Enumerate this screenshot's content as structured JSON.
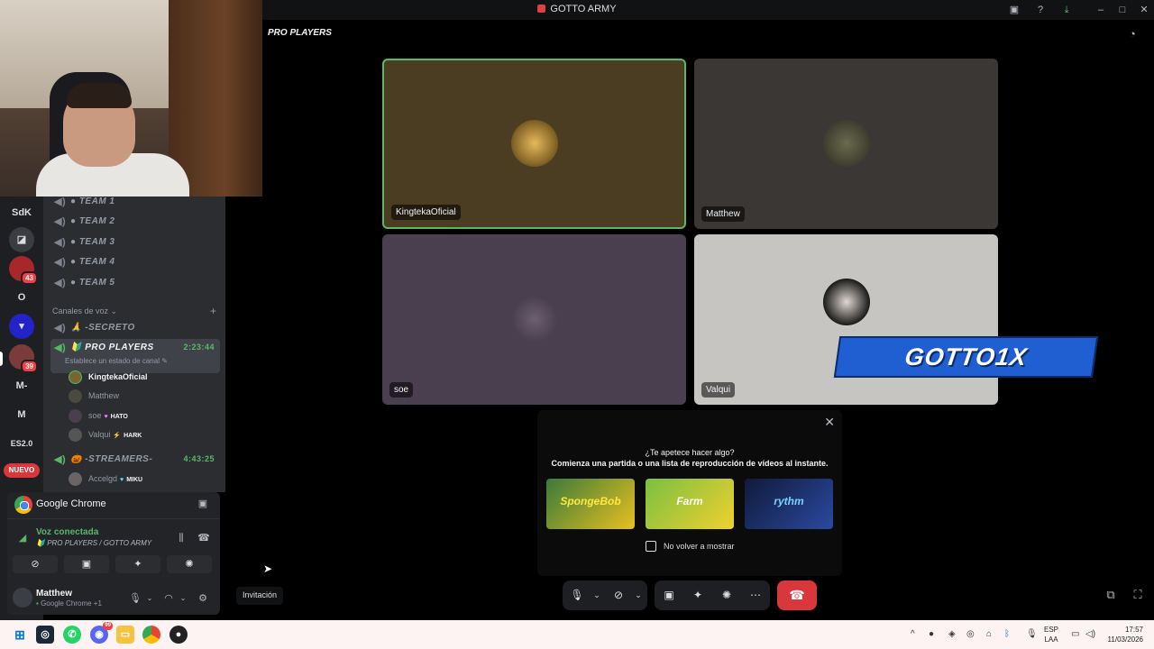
{
  "window": {
    "title": "GOTTO ARMY"
  },
  "stage": {
    "channel_name": "PRO PLAYERS",
    "tiles": [
      {
        "name": "KingtekaOficial",
        "bg": "#4a3d22"
      },
      {
        "name": "Matthew",
        "bg": "#3a3734"
      },
      {
        "name": "soe",
        "bg": "#4a3f4f"
      },
      {
        "name": "Valqui",
        "bg": "#c7c5c2"
      }
    ],
    "overlay_text": "GOTTO1X"
  },
  "servers": [
    {
      "label": "SdK"
    },
    {
      "label": ""
    },
    {
      "label": "",
      "badge": "43"
    },
    {
      "label": "O"
    },
    {
      "label": ""
    },
    {
      "label": "",
      "badge": "39"
    },
    {
      "label": "M-"
    },
    {
      "label": "M"
    },
    {
      "label": "ES2.0"
    },
    {
      "label": "NUEVO"
    }
  ],
  "channels": {
    "text_teams": [
      "TEAM 1",
      "TEAM 2",
      "TEAM 3",
      "TEAM 4",
      "TEAM 5"
    ],
    "voice_category": "Canales de voz",
    "secret": "-SECRETO",
    "active": {
      "name": "PRO PLAYERS",
      "time": "2:23:44",
      "status": "Establece un estado de canal"
    },
    "members": [
      {
        "name": "KingtekaOficial",
        "tag": ""
      },
      {
        "name": "Matthew",
        "tag": ""
      },
      {
        "name": "soe",
        "tag": "HATO"
      },
      {
        "name": "Valqui",
        "tag": "HARK"
      }
    ],
    "streamers": {
      "name": "-STREAMERS-",
      "time": "4:43:25",
      "member": {
        "name": "Accelgd",
        "tag": "MIKU"
      }
    }
  },
  "panel": {
    "app_name": "Google Chrome",
    "voice_status": "Voz conectada",
    "voice_location": "PRO PLAYERS / GOTTO ARMY",
    "user": {
      "name": "Matthew",
      "status": "Google Chrome +1"
    }
  },
  "tooltip": "Invitación",
  "activity": {
    "question": "¿Te apetece hacer algo?",
    "description": "Comienza una partida o una lista de reproducción de vídeos al instante.",
    "games": [
      "SpongeBob",
      "Farm",
      "rythm"
    ],
    "dont_show": "No volver a mostrar"
  },
  "taskbar": {
    "lang": "ESP",
    "lang_sub": "LAA",
    "time": "17:57",
    "date": "11/03/2026",
    "discord_badge": "99"
  }
}
